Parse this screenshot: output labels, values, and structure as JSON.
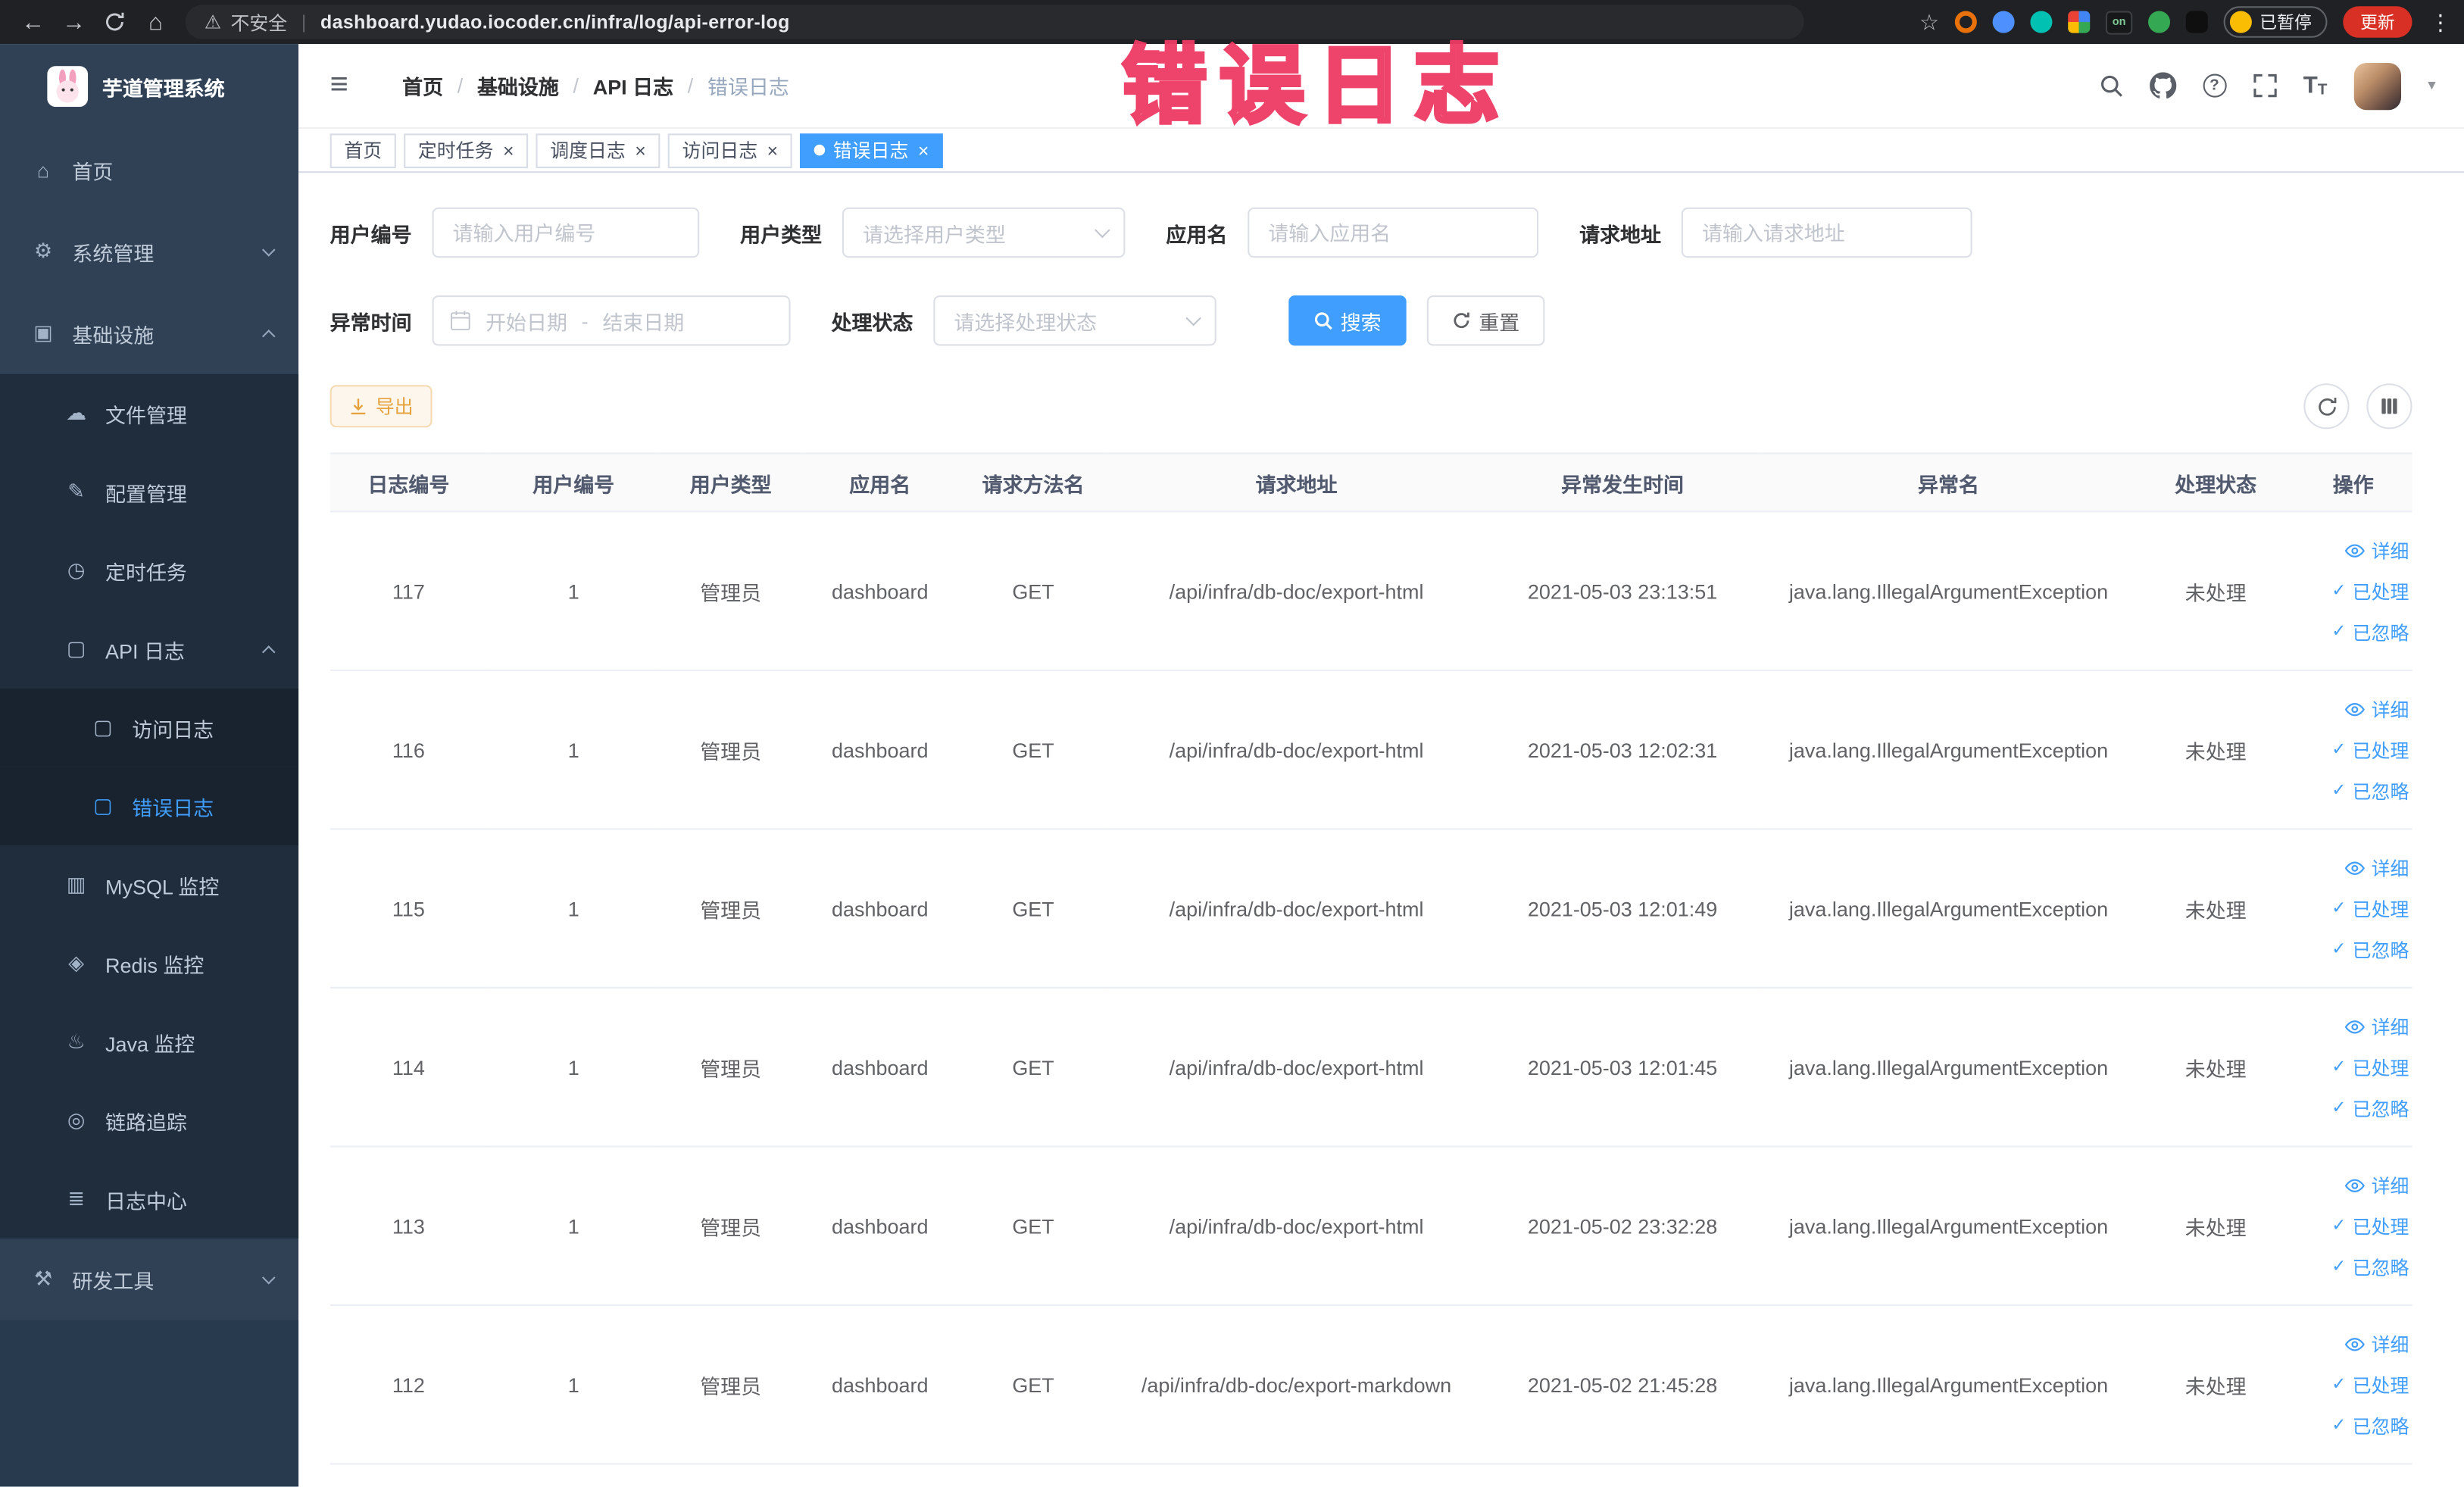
{
  "browser": {
    "security_label": "不安全",
    "url": "dashboard.yudao.iocoder.cn/infra/log/api-error-log",
    "extension_on_badge": "on",
    "profile_badge": "已暂停",
    "update_button": "更新"
  },
  "sidebar": {
    "logo_title": "芋道管理系统",
    "items": [
      {
        "label": "首页"
      },
      {
        "label": "系统管理"
      },
      {
        "label": "基础设施"
      },
      {
        "label": "文件管理"
      },
      {
        "label": "配置管理"
      },
      {
        "label": "定时任务"
      },
      {
        "label": "API 日志"
      },
      {
        "label": "访问日志"
      },
      {
        "label": "错误日志",
        "active": true
      },
      {
        "label": "MySQL 监控"
      },
      {
        "label": "Redis 监控"
      },
      {
        "label": "Java 监控"
      },
      {
        "label": "链路追踪"
      },
      {
        "label": "日志中心"
      },
      {
        "label": "研发工具"
      }
    ]
  },
  "header": {
    "breadcrumb": [
      "首页",
      "基础设施",
      "API 日志",
      "错误日志"
    ],
    "watermark": "错误日志"
  },
  "tabs": [
    {
      "label": "首页",
      "closable": false,
      "active": false
    },
    {
      "label": "定时任务",
      "closable": true,
      "active": false
    },
    {
      "label": "调度日志",
      "closable": true,
      "active": false
    },
    {
      "label": "访问日志",
      "closable": true,
      "active": false
    },
    {
      "label": "错误日志",
      "closable": true,
      "active": true
    }
  ],
  "filters": {
    "user_id": {
      "label": "用户编号",
      "placeholder": "请输入用户编号"
    },
    "user_type": {
      "label": "用户类型",
      "placeholder": "请选择用户类型"
    },
    "app_name": {
      "label": "应用名",
      "placeholder": "请输入应用名"
    },
    "request_url": {
      "label": "请求地址",
      "placeholder": "请输入请求地址"
    },
    "exception_time": {
      "label": "异常时间",
      "start_placeholder": "开始日期",
      "separator": "-",
      "end_placeholder": "结束日期"
    },
    "process_status": {
      "label": "处理状态",
      "placeholder": "请选择处理状态"
    },
    "search_button": "搜索",
    "reset_button": "重置"
  },
  "toolbar": {
    "export_button": "导出"
  },
  "table": {
    "columns": [
      "日志编号",
      "用户编号",
      "用户类型",
      "应用名",
      "请求方法名",
      "请求地址",
      "异常发生时间",
      "异常名",
      "处理状态",
      "操作"
    ],
    "actions": [
      "详细",
      "已处理",
      "已忽略"
    ],
    "rows": [
      {
        "id": "117",
        "user_id": "1",
        "user_type": "管理员",
        "app": "dashboard",
        "method": "GET",
        "url": "/api/infra/db-doc/export-html",
        "time": "2021-05-03 23:13:51",
        "exception": "java.lang.IllegalArgumentException",
        "status": "未处理"
      },
      {
        "id": "116",
        "user_id": "1",
        "user_type": "管理员",
        "app": "dashboard",
        "method": "GET",
        "url": "/api/infra/db-doc/export-html",
        "time": "2021-05-03 12:02:31",
        "exception": "java.lang.IllegalArgumentException",
        "status": "未处理"
      },
      {
        "id": "115",
        "user_id": "1",
        "user_type": "管理员",
        "app": "dashboard",
        "method": "GET",
        "url": "/api/infra/db-doc/export-html",
        "time": "2021-05-03 12:01:49",
        "exception": "java.lang.IllegalArgumentException",
        "status": "未处理"
      },
      {
        "id": "114",
        "user_id": "1",
        "user_type": "管理员",
        "app": "dashboard",
        "method": "GET",
        "url": "/api/infra/db-doc/export-html",
        "time": "2021-05-03 12:01:45",
        "exception": "java.lang.IllegalArgumentException",
        "status": "未处理"
      },
      {
        "id": "113",
        "user_id": "1",
        "user_type": "管理员",
        "app": "dashboard",
        "method": "GET",
        "url": "/api/infra/db-doc/export-html",
        "time": "2021-05-02 23:32:28",
        "exception": "java.lang.IllegalArgumentException",
        "status": "未处理"
      },
      {
        "id": "112",
        "user_id": "1",
        "user_type": "管理员",
        "app": "dashboard",
        "method": "GET",
        "url": "/api/infra/db-doc/export-markdown",
        "time": "2021-05-02 21:45:28",
        "exception": "java.lang.IllegalArgumentException",
        "status": "未处理"
      }
    ]
  },
  "colors": {
    "accent_blue": "#409eff",
    "sidebar_bg": "#304156",
    "submenu_bg": "#1f2d3d",
    "warning_orange": "#e6a23c",
    "watermark_pink": "#ee3b64",
    "table_border": "#ebeef5"
  }
}
